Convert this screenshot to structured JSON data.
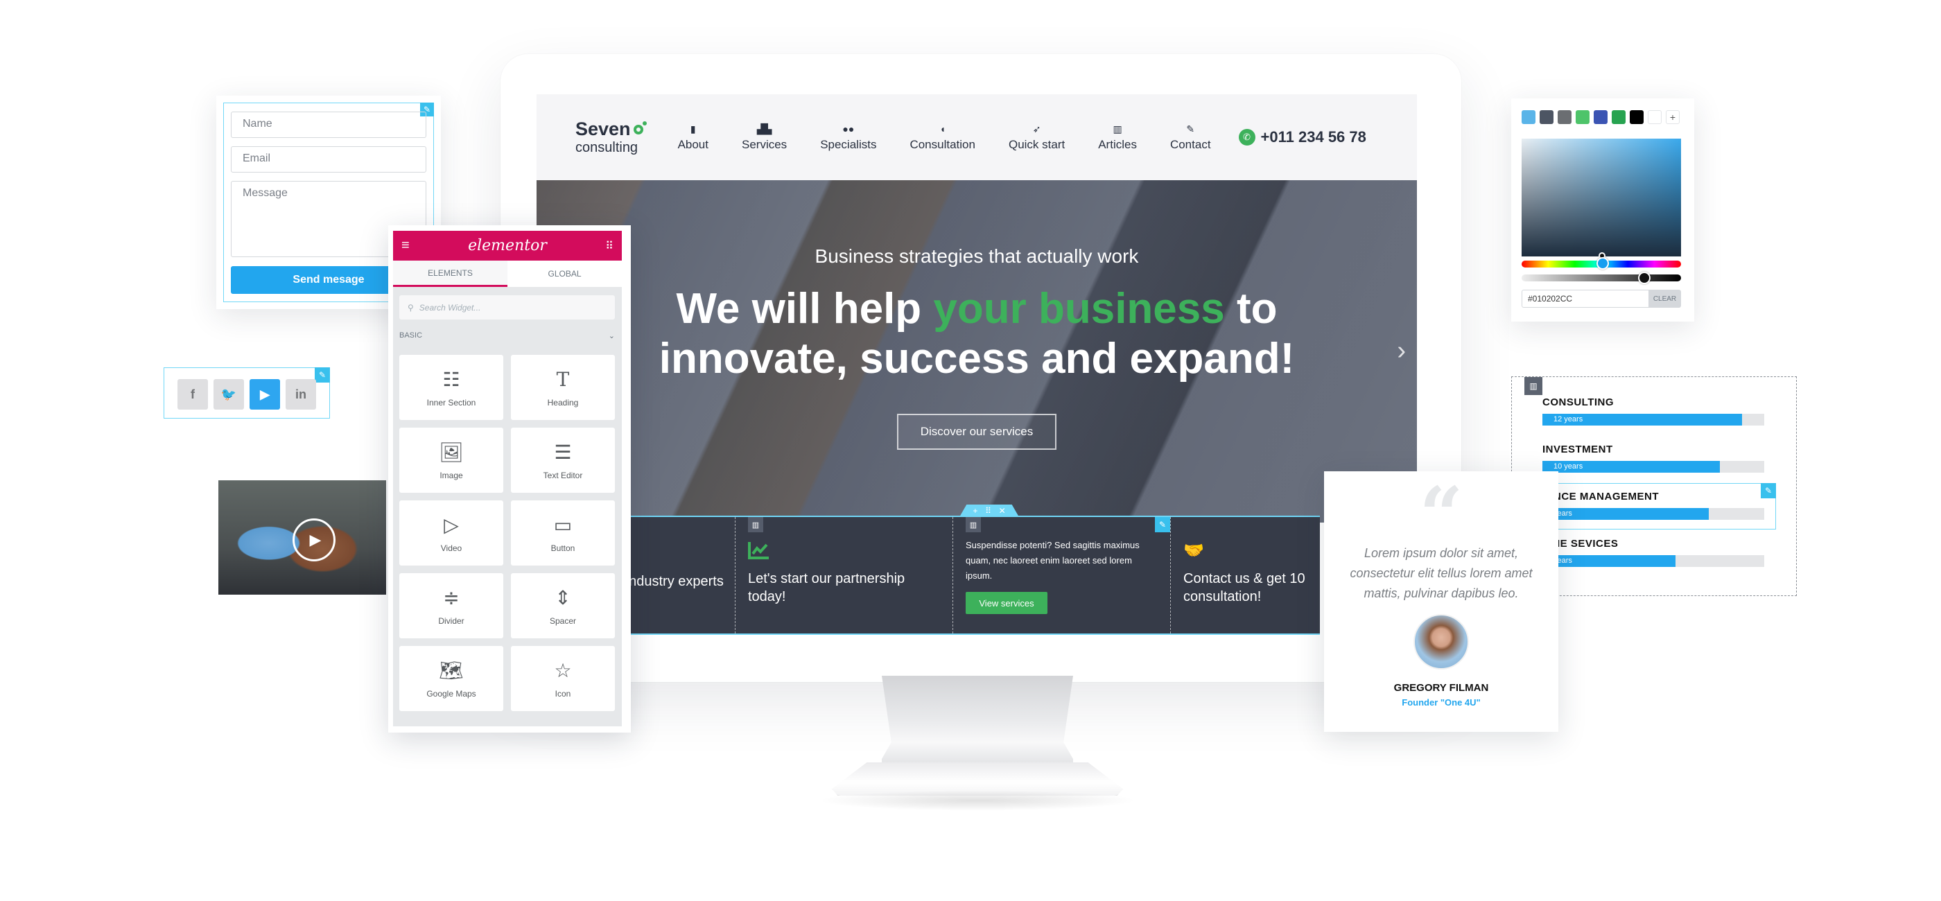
{
  "site": {
    "logo_top": "Seven",
    "logo_bottom": "consulting",
    "nav": [
      {
        "label": "About",
        "icon": "tie-icon",
        "glyph": "▮"
      },
      {
        "label": "Services",
        "icon": "boxes-icon",
        "glyph": "▟▙"
      },
      {
        "label": "Specialists",
        "icon": "users-icon",
        "glyph": "●●"
      },
      {
        "label": "Consultation",
        "icon": "chat-dollar-icon",
        "glyph": "◖"
      },
      {
        "label": "Quick start",
        "icon": "rocket-icon",
        "glyph": "➶"
      },
      {
        "label": "Articles",
        "icon": "book-icon",
        "glyph": "▥"
      },
      {
        "label": "Contact",
        "icon": "pen-icon",
        "glyph": "✎"
      }
    ],
    "phone": "+011 234 56 78",
    "phone_glyph": "✆"
  },
  "hero": {
    "subtitle": "Business strategies that actually work",
    "title_part1": "We will help ",
    "title_highlight": "your business",
    "title_part2": " to",
    "title_line2": "innovate, success and expand!",
    "button": "Discover our services",
    "next_glyph": "›"
  },
  "features": {
    "section_handle": {
      "add": "+",
      "move": "⠿",
      "close": "✕"
    },
    "col1_text": "g industry experts",
    "col2_icon": "chart-line-icon",
    "col2_glyph": "📈",
    "col2_text": "Let's start our partnership today!",
    "col3_text": "Suspendisse potenti? Sed sagittis maximus quam, nec laoreet enim laoreet sed lorem ipsum.",
    "col3_button": "View services",
    "col4_glyph": "🤝",
    "col4_text": "Contact us & get 10 consultation!"
  },
  "form": {
    "name_placeholder": "Name",
    "email_placeholder": "Email",
    "message_placeholder": "Message",
    "send_label": "Send mesage"
  },
  "social": [
    {
      "name": "facebook",
      "glyph": "f",
      "active": false
    },
    {
      "name": "twitter",
      "glyph": "🐦",
      "active": false
    },
    {
      "name": "youtube",
      "glyph": "▶",
      "active": true
    },
    {
      "name": "linkedin",
      "glyph": "in",
      "active": false
    }
  ],
  "video": {
    "play_glyph": "▶"
  },
  "elementor": {
    "logo": "elementor",
    "tabs": [
      "ELEMENTS",
      "GLOBAL"
    ],
    "active_tab": "ELEMENTS",
    "search_placeholder": "Search Widget...",
    "category": "BASIC",
    "widgets": [
      {
        "label": "Inner Section",
        "icon": "inner-section-icon",
        "glyph": "☷"
      },
      {
        "label": "Heading",
        "icon": "heading-icon",
        "glyph": "T"
      },
      {
        "label": "Image",
        "icon": "image-icon",
        "glyph": "🖼"
      },
      {
        "label": "Text Editor",
        "icon": "text-editor-icon",
        "glyph": "☰"
      },
      {
        "label": "Video",
        "icon": "video-icon",
        "glyph": "▷"
      },
      {
        "label": "Button",
        "icon": "button-icon",
        "glyph": "▭"
      },
      {
        "label": "Divider",
        "icon": "divider-icon",
        "glyph": "≑"
      },
      {
        "label": "Spacer",
        "icon": "spacer-icon",
        "glyph": "⇕"
      },
      {
        "label": "Google Maps",
        "icon": "google-maps-icon",
        "glyph": "🗺"
      },
      {
        "label": "Icon",
        "icon": "star-icon",
        "glyph": "☆"
      }
    ]
  },
  "color_picker": {
    "swatches": [
      "#5ab4e8",
      "#4d5563",
      "#6b6e72",
      "#4ec46a",
      "#3b54b3",
      "#27a350",
      "#000000",
      "#ffffff"
    ],
    "hex_value": "#010202CC",
    "clear_label": "CLEAR",
    "add_glyph": "+"
  },
  "progress": [
    {
      "title": "CONSULTING",
      "label": "12 years",
      "percent": 90
    },
    {
      "title": "INVESTMENT",
      "label": "10 years",
      "percent": 80
    },
    {
      "title": "IANCE MANAGEMENT",
      "label": "years",
      "percent": 75
    },
    {
      "title": "LINE SEVICES",
      "label": "years",
      "percent": 60
    }
  ],
  "testimonial": {
    "quote_glyph": "“",
    "text": "Lorem ipsum dolor sit amet, consectetur elit tellus lorem amet mattis, pulvinar dapibus leo.",
    "name": "GREGORY FILMAN",
    "role": "Founder \"One 4U\""
  },
  "colors": {
    "accent_green": "#3db15b",
    "accent_blue": "#22a6ee",
    "elementor_pink": "#d30c5c",
    "dark_bar": "#363b48"
  }
}
